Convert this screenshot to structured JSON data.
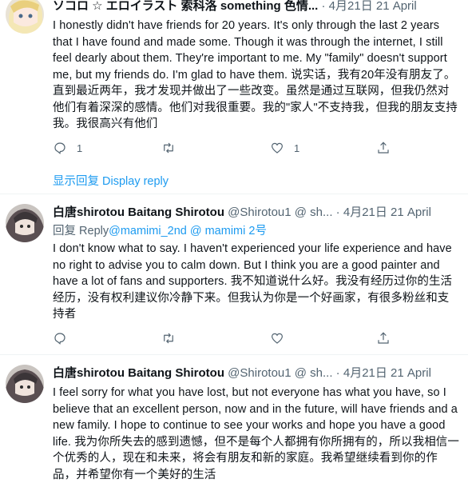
{
  "tweets": [
    {
      "name": "ソコロ ☆ エロイラスト 索科洛 something 色情...",
      "meta": "· 4月21日 21 April",
      "text": "I honestly didn't have friends for 20 years. It's only through the last 2 years that I have found and made some. Though it was through the internet, I still feel dearly about them. They're important to me. My \"family\" doesn't support me, but my friends do. I'm glad to have them. 说实话，我有20年没有朋友了。直到最近两年，我才发现并做出了一些改变。虽然是通过互联网，但我仍然对他们有着深深的感情。他们对我很重要。我的\"家人\"不支持我，但我的朋友支持我。我很高兴有他们",
      "replies": "1",
      "retweets": "",
      "likes": "1",
      "display_reply": "显示回复 Display reply"
    },
    {
      "name": "白唐shirotou Baitang Shirotou",
      "meta": "@Shirotou1 @ sh... · 4月21日 21 April",
      "reply_prefix": "回复  Reply",
      "reply_mention": "@mamimi_2nd @ mamimi 2号",
      "text": "I don't know what to say. I haven't experienced your life experience and have no right to advise you to calm down. But I think you are a good painter and have a lot of fans and supporters. 我不知道说什么好。我没有经历过你的生活经历，没有权利建议你冷静下来。但我认为你是一个好画家，有很多粉丝和支持者",
      "replies": "",
      "retweets": "",
      "likes": ""
    },
    {
      "name": "白唐shirotou Baitang Shirotou",
      "meta": "@Shirotou1 @ sh... · 4月21日 21 April",
      "text": "I feel sorry for what you have lost, but not everyone has what you have, so I believe that an excellent person, now and in the future, will have friends and a new family. I hope to continue to see your works and hope you have a good life. 我为你所失去的感到遗憾，但不是每个人都拥有你所拥有的，所以我相信一个优秀的人，现在和未来，将会有朋友和新的家庭。我希望继续看到你的作品，并希望你有一个美好的生活"
    }
  ],
  "icons": [
    "reply-icon",
    "retweet-icon",
    "like-icon",
    "share-icon"
  ],
  "colors": {
    "accent": "#1d9bf0",
    "muted": "#536471",
    "divider": "#eff3f4"
  }
}
